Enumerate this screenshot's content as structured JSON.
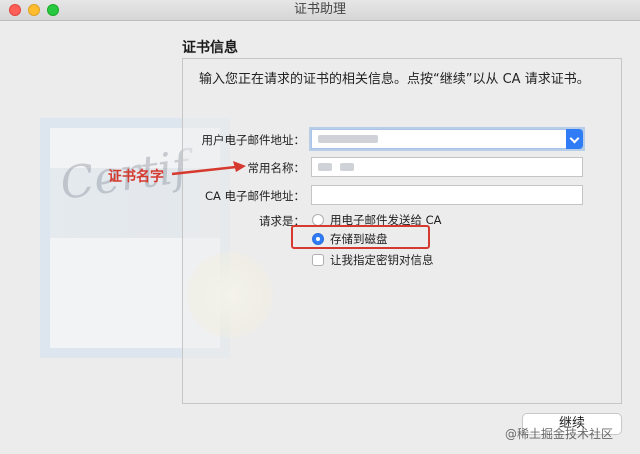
{
  "window": {
    "title": "证书助理"
  },
  "heading": "证书信息",
  "instructions": "输入您正在请求的证书的相关信息。点按“继续”以从 CA 请求证书。",
  "form": {
    "user_email_label": "用户电子邮件地址：",
    "common_name_label": "常用名称：",
    "ca_email_label": "CA 电子邮件地址：",
    "request_label": "请求是：",
    "options": {
      "email_to_ca": "用电子邮件发送给 CA",
      "save_to_disk": "存储到磁盘",
      "specify_key_pair": "让我指定密钥对信息"
    },
    "selected_option": "save_to_disk"
  },
  "annotation": {
    "text": "证书名字",
    "color": "#d63a2f"
  },
  "buttons": {
    "continue": "继续"
  },
  "watermark": "@稀土掘金技术社区",
  "colors": {
    "accent": "#2f7cf6"
  }
}
